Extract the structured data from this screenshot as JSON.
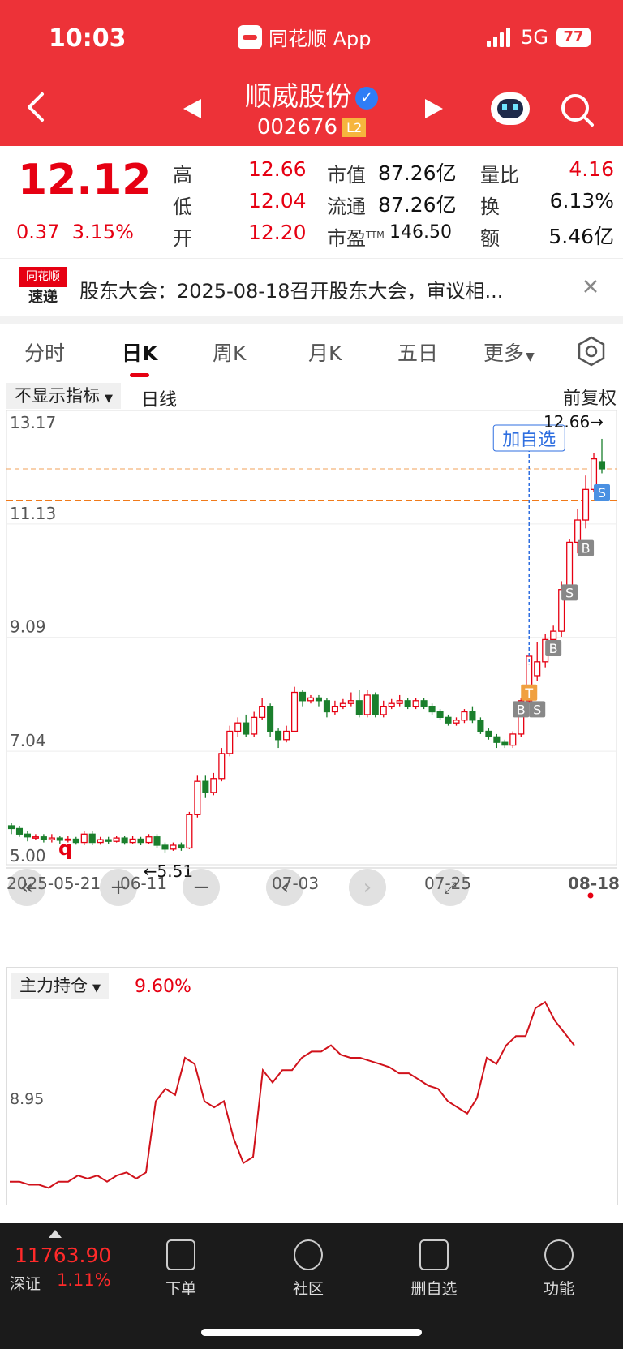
{
  "status_bar": {
    "time": "10:03",
    "app_name": "同花顺 App",
    "network": "5G",
    "battery": "77"
  },
  "header": {
    "stock_name": "顺威股份",
    "stock_code": "002676",
    "level_badge": "L2"
  },
  "quote": {
    "price": "12.12",
    "change": "0.37",
    "change_pct": "3.15%",
    "high_label": "高",
    "high": "12.66",
    "low_label": "低",
    "low": "12.04",
    "open_label": "开",
    "open": "12.20",
    "mktcap_label": "市值",
    "mktcap": "87.26亿",
    "float_label": "流通",
    "float": "87.26亿",
    "pe_label": "市盈",
    "pe_sup": "TTM",
    "pe": "146.50",
    "vol_ratio_label": "量比",
    "vol_ratio": "4.16",
    "turnover_label": "换",
    "turnover": "6.13%",
    "amount_label": "额",
    "amount": "5.46亿"
  },
  "news": {
    "logo_top": "同花顺",
    "logo_bottom": "速递",
    "text": "股东大会：2025-08-18召开股东大会，审议相..."
  },
  "tabs": [
    {
      "label": "分时"
    },
    {
      "label": "日K"
    },
    {
      "label": "周K"
    },
    {
      "label": "月K"
    },
    {
      "label": "五日"
    },
    {
      "label": "更多"
    }
  ],
  "kline": {
    "indicator_chip": "不显示指标",
    "period_label": "日线",
    "adjust_label": "前复权",
    "watch_button": "加自选",
    "high_marker": "12.66→",
    "low_marker": "←5.51",
    "q_mark": "q"
  },
  "lower": {
    "indicator_label": "主力持仓",
    "indicator_value": "9.60%",
    "axis_label": "8.95"
  },
  "bottom_bar": {
    "index_value": "11763.90",
    "index_name": "深证",
    "index_change": "1.11%",
    "order": "下单",
    "community": "社区",
    "remove_watch": "删自选",
    "functions": "功能"
  },
  "colors": {
    "up": "#e60012",
    "down": "#1a7f2c",
    "header_bg": "#ed3238"
  },
  "chart_data": [
    {
      "type": "candlestick",
      "title": "",
      "ylim": [
        5.0,
        13.17
      ],
      "y_ticks": [
        "13.17",
        "11.13",
        "9.09",
        "7.04",
        "5.00"
      ],
      "x_ticks": [
        "2025-05-21",
        "06-11",
        "07-03",
        "07-25",
        "08-18"
      ],
      "candles": [
        [
          5.7,
          5.65,
          5.75,
          5.55
        ],
        [
          5.65,
          5.55,
          5.7,
          5.5
        ],
        [
          5.55,
          5.5,
          5.6,
          5.42
        ],
        [
          5.5,
          5.5,
          5.55,
          5.45
        ],
        [
          5.5,
          5.45,
          5.55,
          5.4
        ],
        [
          5.45,
          5.48,
          5.55,
          5.4
        ],
        [
          5.48,
          5.44,
          5.52,
          5.38
        ],
        [
          5.44,
          5.46,
          5.52,
          5.4
        ],
        [
          5.46,
          5.4,
          5.5,
          5.36
        ],
        [
          5.4,
          5.55,
          5.6,
          5.35
        ],
        [
          5.55,
          5.4,
          5.6,
          5.35
        ],
        [
          5.4,
          5.45,
          5.5,
          5.36
        ],
        [
          5.45,
          5.42,
          5.5,
          5.38
        ],
        [
          5.42,
          5.48,
          5.52,
          5.4
        ],
        [
          5.48,
          5.4,
          5.52,
          5.36
        ],
        [
          5.4,
          5.46,
          5.52,
          5.38
        ],
        [
          5.46,
          5.4,
          5.5,
          5.35
        ],
        [
          5.4,
          5.5,
          5.55,
          5.38
        ],
        [
          5.5,
          5.35,
          5.55,
          5.3
        ],
        [
          5.35,
          5.28,
          5.4,
          5.22
        ],
        [
          5.28,
          5.35,
          5.4,
          5.25
        ],
        [
          5.35,
          5.3,
          5.4,
          5.25
        ],
        [
          5.3,
          5.9,
          5.95,
          5.28
        ],
        [
          5.9,
          6.5,
          6.6,
          5.85
        ],
        [
          6.5,
          6.3,
          6.6,
          6.2
        ],
        [
          6.3,
          6.55,
          6.65,
          6.25
        ],
        [
          6.55,
          7.0,
          7.1,
          6.5
        ],
        [
          7.0,
          7.4,
          7.5,
          6.95
        ],
        [
          7.4,
          7.55,
          7.65,
          7.3
        ],
        [
          7.55,
          7.35,
          7.7,
          7.3
        ],
        [
          7.35,
          7.65,
          7.75,
          7.3
        ],
        [
          7.65,
          7.85,
          8.0,
          7.6
        ],
        [
          7.85,
          7.4,
          7.9,
          7.3
        ],
        [
          7.4,
          7.25,
          7.45,
          7.1
        ],
        [
          7.25,
          7.4,
          7.5,
          7.2
        ],
        [
          7.4,
          8.1,
          8.2,
          7.38
        ],
        [
          8.1,
          7.95,
          8.15,
          7.85
        ],
        [
          7.95,
          8.0,
          8.05,
          7.9
        ],
        [
          8.0,
          7.95,
          8.05,
          7.85
        ],
        [
          7.95,
          7.75,
          8.0,
          7.65
        ],
        [
          7.75,
          7.85,
          7.95,
          7.7
        ],
        [
          7.85,
          7.9,
          7.98,
          7.8
        ],
        [
          7.9,
          7.95,
          8.1,
          7.85
        ],
        [
          7.95,
          7.7,
          8.15,
          7.65
        ],
        [
          7.7,
          8.05,
          8.15,
          7.65
        ],
        [
          8.05,
          7.7,
          8.1,
          7.65
        ],
        [
          7.7,
          7.85,
          7.95,
          7.65
        ],
        [
          7.85,
          7.9,
          7.98,
          7.8
        ],
        [
          7.9,
          7.95,
          8.05,
          7.85
        ],
        [
          7.95,
          7.85,
          8.0,
          7.8
        ],
        [
          7.85,
          7.95,
          8.0,
          7.8
        ],
        [
          7.95,
          7.85,
          8.0,
          7.8
        ],
        [
          7.85,
          7.75,
          7.9,
          7.7
        ],
        [
          7.75,
          7.65,
          7.8,
          7.6
        ],
        [
          7.65,
          7.55,
          7.7,
          7.5
        ],
        [
          7.55,
          7.6,
          7.65,
          7.5
        ],
        [
          7.6,
          7.75,
          7.8,
          7.55
        ],
        [
          7.75,
          7.6,
          7.85,
          7.55
        ],
        [
          7.6,
          7.4,
          7.65,
          7.35
        ],
        [
          7.4,
          7.3,
          7.45,
          7.25
        ],
        [
          7.3,
          7.2,
          7.35,
          7.1
        ],
        [
          7.2,
          7.15,
          7.25,
          7.1
        ],
        [
          7.15,
          7.35,
          7.4,
          7.1
        ],
        [
          7.35,
          7.95,
          8.0,
          7.3
        ],
        [
          7.95,
          8.75,
          8.8,
          7.9
        ],
        [
          8.4,
          8.65,
          9.0,
          8.3
        ],
        [
          8.65,
          9.05,
          9.15,
          8.55
        ],
        [
          9.05,
          9.2,
          9.3,
          8.9
        ],
        [
          9.2,
          9.95,
          10.1,
          9.1
        ],
        [
          9.95,
          10.8,
          10.85,
          9.85
        ],
        [
          10.8,
          11.2,
          11.4,
          10.6
        ],
        [
          11.2,
          11.75,
          12.0,
          11.05
        ],
        [
          11.75,
          12.3,
          12.4,
          11.7
        ],
        [
          12.25,
          12.12,
          12.66,
          12.04
        ]
      ]
    },
    {
      "type": "line",
      "title": "",
      "series": [
        {
          "name": "主力持仓",
          "values": [
            4.2,
            4.2,
            4.15,
            4.15,
            4.1,
            4.2,
            4.2,
            4.3,
            4.25,
            4.3,
            4.2,
            4.3,
            4.35,
            4.25,
            4.35,
            5.5,
            5.7,
            5.6,
            6.2,
            6.1,
            5.5,
            5.4,
            5.5,
            4.9,
            4.5,
            4.6,
            6.0,
            5.8,
            6.0,
            6.0,
            6.2,
            6.3,
            6.3,
            6.4,
            6.25,
            6.2,
            6.2,
            6.15,
            6.1,
            6.05,
            5.95,
            5.95,
            5.85,
            5.75,
            5.7,
            5.5,
            5.4,
            5.3,
            5.55,
            6.2,
            6.1,
            6.4,
            6.55,
            6.55,
            7.0,
            7.1,
            6.8,
            6.6,
            6.4
          ]
        }
      ]
    }
  ]
}
